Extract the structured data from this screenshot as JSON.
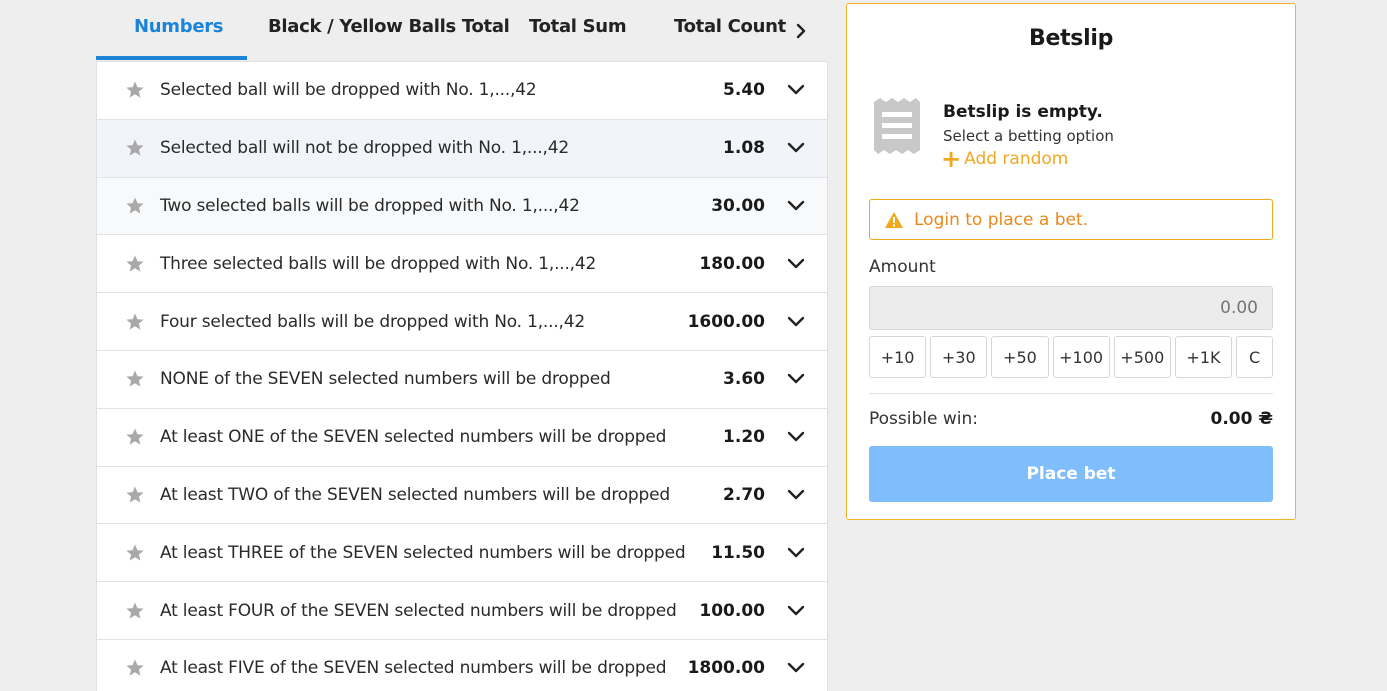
{
  "tabs": [
    {
      "label": "Numbers",
      "active": true
    },
    {
      "label": "Black / Yellow Balls Total",
      "active": false
    },
    {
      "label": "Total Sum",
      "active": false
    },
    {
      "label": "Total Count",
      "active": false
    }
  ],
  "tab_next_icon": "chevron-right-icon",
  "markets": [
    {
      "label": "Selected ball will be dropped with No. 1,...,42",
      "odds": "5.40"
    },
    {
      "label": "Selected ball will not be dropped with No. 1,...,42",
      "odds": "1.08"
    },
    {
      "label": "Two selected balls will be dropped with No. 1,...,42",
      "odds": "30.00"
    },
    {
      "label": "Three selected balls will be dropped with No. 1,...,42",
      "odds": "180.00"
    },
    {
      "label": "Four selected balls will be dropped with No. 1,...,42",
      "odds": "1600.00"
    },
    {
      "label": "NONE of the SEVEN selected numbers will be dropped",
      "odds": "3.60"
    },
    {
      "label": "At least ONE of the SEVEN selected numbers will be dropped",
      "odds": "1.20"
    },
    {
      "label": "At least TWO of the SEVEN selected numbers will be dropped",
      "odds": "2.70"
    },
    {
      "label": "At least THREE of the SEVEN selected numbers will be dropped",
      "odds": "11.50"
    },
    {
      "label": "At least FOUR of the SEVEN selected numbers will be dropped",
      "odds": "100.00"
    },
    {
      "label": "At least FIVE of the SEVEN selected numbers will be dropped",
      "odds": "1800.00"
    }
  ],
  "betslip": {
    "title": "Betslip",
    "empty_title": "Betslip is empty.",
    "empty_sub": "Select a betting option",
    "add_random_plus": "+",
    "add_random": "Add random",
    "login_warning": "Login to place a bet.",
    "amount_label": "Amount",
    "amount_placeholder": "0.00",
    "quick_amounts": [
      "+10",
      "+30",
      "+50",
      "+100",
      "+500",
      "+1K"
    ],
    "clear_label": "C",
    "possible_win_label": "Possible win:",
    "possible_win_value": "0.00 ₴",
    "place_bet_label": "Place bet"
  },
  "colors": {
    "accent_blue": "#1b84d7",
    "warning_orange": "#f0a81c",
    "place_bet_disabled": "#80bdfc"
  }
}
